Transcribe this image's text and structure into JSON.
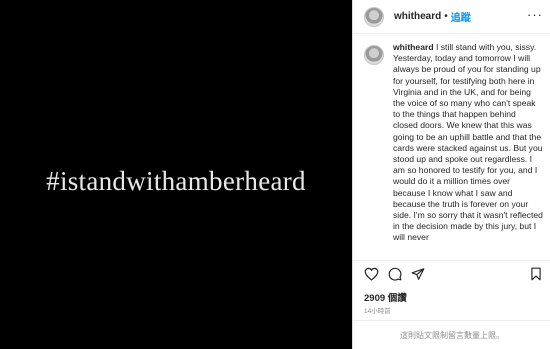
{
  "post": {
    "hashtag_text": "#istandwithamberheard"
  },
  "header": {
    "username": "whitheard",
    "separator": "•",
    "follow_label": "追蹤",
    "more_icon": "more-horizontal-icon"
  },
  "comment": {
    "username": "whitheard",
    "text": "I still stand with you, sissy. Yesterday, today and tomorrow I will always be proud of you for standing up for yourself, for testifying both here in Virginia and in the UK, and for being the voice of so many who can't speak to the things that happen behind closed doors. We knew that this was going to be an uphill battle and that the cards were stacked against us. But you stood up and spoke out regardless. I am so honored to testify for you, and I would do it a million times over because I know what I saw and because the truth is forever on your side. I'm so sorry that it wasn't reflected in the decision made by this jury, but I will never"
  },
  "actions": {
    "icons": [
      "heart-icon",
      "comment-icon",
      "share-icon",
      "bookmark-icon"
    ]
  },
  "likes_text": "2909 個讚",
  "timestamp": "14小時前",
  "comments_disabled_text": "這則貼文限制留言數量上限。",
  "colors": {
    "link_blue": "#0095f6",
    "text": "#262626",
    "muted": "#8e8e8e",
    "media_bg": "#000000"
  }
}
